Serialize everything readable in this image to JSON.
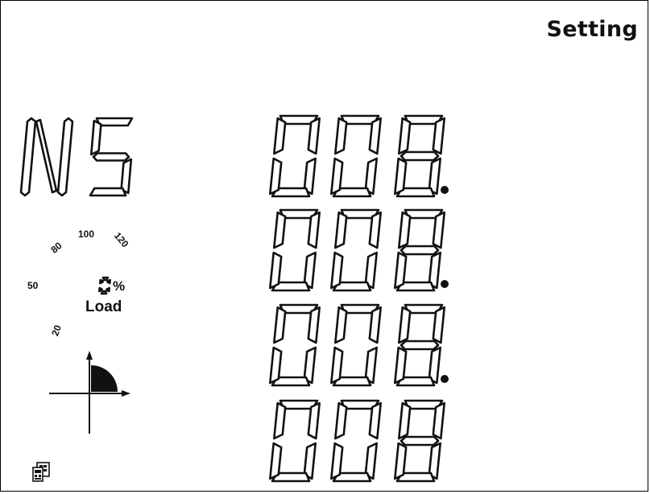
{
  "header": {
    "mode": "Setting"
  },
  "parameter": {
    "code": "NS"
  },
  "display_rows": [
    {
      "digits": [
        "0",
        "0",
        "8"
      ],
      "decimal_point": true
    },
    {
      "digits": [
        "0",
        "0",
        "8"
      ],
      "decimal_point": true
    },
    {
      "digits": [
        "0",
        "0",
        "8"
      ],
      "decimal_point": true
    },
    {
      "digits": [
        "0",
        "0",
        "8"
      ],
      "decimal_point": false
    }
  ],
  "load_gauge": {
    "ticks": [
      "20",
      "50",
      "80",
      "100",
      "120"
    ],
    "value_digit": "0",
    "unit": "%",
    "label": "Load"
  },
  "quadrant_indicator": {
    "active_quadrant": 1
  },
  "icons": {
    "communication": "communication-icon",
    "quadrant": "quadrant-indicator-icon"
  },
  "colors": {
    "segment_stroke": "#111111",
    "background": "#ffffff"
  }
}
